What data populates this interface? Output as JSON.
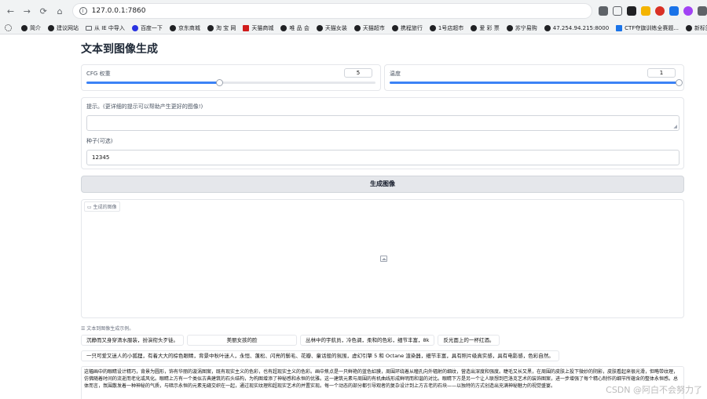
{
  "browser": {
    "url": "127.0.0.1:7860",
    "nav": {
      "back": "←",
      "forward": "→",
      "reload": "⟳",
      "home": "⌂"
    }
  },
  "bookmarks": [
    {
      "label": "简介"
    },
    {
      "label": "建议网站"
    },
    {
      "label": "从 IE 中导入"
    },
    {
      "label": "百度一下"
    },
    {
      "label": "京东商城"
    },
    {
      "label": "淘 宝 网"
    },
    {
      "label": "天猫商城"
    },
    {
      "label": "唯 品 会"
    },
    {
      "label": "天猫女装"
    },
    {
      "label": "天猫超市"
    },
    {
      "label": "携程旅行"
    },
    {
      "label": "1号店超市"
    },
    {
      "label": "爱 彩 票"
    },
    {
      "label": "苏宁易购"
    },
    {
      "label": "47.254.94.215:8000"
    },
    {
      "label": "CTF夺旗训练全赛题..."
    },
    {
      "label": "新标签页"
    }
  ],
  "page": {
    "title": "文本到图像生成",
    "cfg": {
      "label": "CFG 权重",
      "value": "5",
      "fraction": 0.46
    },
    "temperature": {
      "label": "温度",
      "value": "1",
      "fraction": 1.0
    },
    "prompt": {
      "label": "提示。(更详细的提示可以帮助产生更好的图像!)",
      "value": ""
    },
    "seed": {
      "label": "种子(可选)",
      "value": "12345"
    },
    "generate_label": "生成图像",
    "image_label": "生成的图像",
    "examples_label": "文本到图像生成示例。",
    "examples_row1": [
      "沉静而又身穿清水服装，扮演衔头歹徒。",
      "美丽女孩的脸",
      "丛林中的宇航员，冷色调，柔和的色彩，细节丰富，8k",
      "反光面上的一杯红酒。"
    ],
    "examples_row2": [
      "一只可爱又迷人的小狐狸，有着大大的棕色眼睛，背景中秋叶迷人，永恒、蓬松、闪亮的鬃毛、花瓣、童话般的氛围，虚幻引擎 5 和 Octane 渲染器，细节丰富，具有照片级真实感，具有电影感，色彩自然。"
    ],
    "example_long": "这幅画中的眼睛设计精巧，背景为圆形，饰有华丽的漩涡图案，既有现实主义的色彩，也有超现实主义的色彩。画中焦点是一只鲜艳的蓝色虹膜，周围环绕着从瞳孔向外辐射的细纹，营造出深度和强度。睫毛又长又黑，在周围的皮肤上投下微妙的阴影，皮肤看起来很光滑，但略带纹理，仿佛随着时间的流逝而老化或风化。眼睛上方有一个类似古典建筑的石头结构，为构图增添了神秘感和永恒的优雅。这一建筑元素与周围的有机曲线形成鲜明而和谐的对比。眼睛下方是另一个让人联想到巴洛克艺术的装饰图案，进一步增强了每个精心制作的细节所蕴含的整体永恒感。总体而言，氛围散发着一种神秘的气质，与暗示永恒的元素无缝交织在一起，通过现实纹理和超现实艺术的并置实现。每一个动态的部分都引导观者的复杂设计到上方古老的石块——以独特的方式创造出充满神秘魅力的视觉盛宴。"
  },
  "watermark": "CSDN @阿白不会努力了"
}
